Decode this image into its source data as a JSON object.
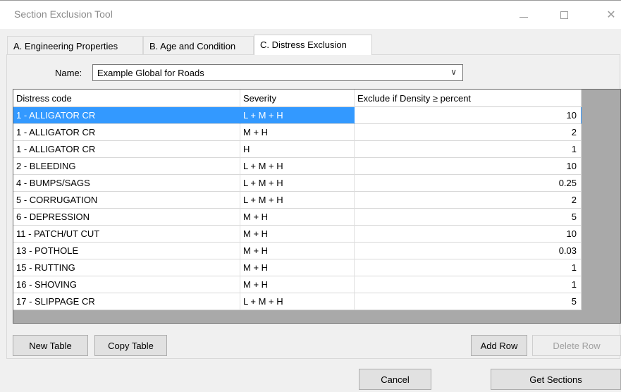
{
  "window": {
    "title": "Section Exclusion Tool"
  },
  "tabs": [
    {
      "label": "A. Engineering Properties"
    },
    {
      "label": "B. Age and Condition"
    },
    {
      "label": "C. Distress Exclusion"
    }
  ],
  "name_field": {
    "label": "Name:",
    "value": "Example Global for Roads"
  },
  "table": {
    "headers": [
      "Distress code",
      "Severity",
      "Exclude if Density ≥ percent"
    ],
    "rows": [
      {
        "code": "1 - ALLIGATOR CR",
        "severity": "L + M + H",
        "percent": "10"
      },
      {
        "code": "1 - ALLIGATOR CR",
        "severity": "M + H",
        "percent": "2"
      },
      {
        "code": "1 - ALLIGATOR CR",
        "severity": "H",
        "percent": "1"
      },
      {
        "code": "2 - BLEEDING",
        "severity": "L + M + H",
        "percent": "10"
      },
      {
        "code": "4 - BUMPS/SAGS",
        "severity": "L + M + H",
        "percent": "0.25"
      },
      {
        "code": "5 - CORRUGATION",
        "severity": "L + M + H",
        "percent": "2"
      },
      {
        "code": "6 - DEPRESSION",
        "severity": "M + H",
        "percent": "5"
      },
      {
        "code": "11 - PATCH/UT CUT",
        "severity": "M + H",
        "percent": "10"
      },
      {
        "code": "13 - POTHOLE",
        "severity": "M + H",
        "percent": "0.03"
      },
      {
        "code": "15 - RUTTING",
        "severity": "M + H",
        "percent": "1"
      },
      {
        "code": "16 - SHOVING",
        "severity": "M + H",
        "percent": "1"
      },
      {
        "code": "17 - SLIPPAGE CR",
        "severity": "L + M + H",
        "percent": "5"
      }
    ]
  },
  "buttons": {
    "new_table": "New Table",
    "copy_table": "Copy Table",
    "add_row": "Add Row",
    "delete_row": "Delete Row",
    "cancel": "Cancel",
    "get_sections": "Get Sections"
  },
  "colors": {
    "selection": "#3399ff",
    "grid_background": "#a9a9a9"
  }
}
